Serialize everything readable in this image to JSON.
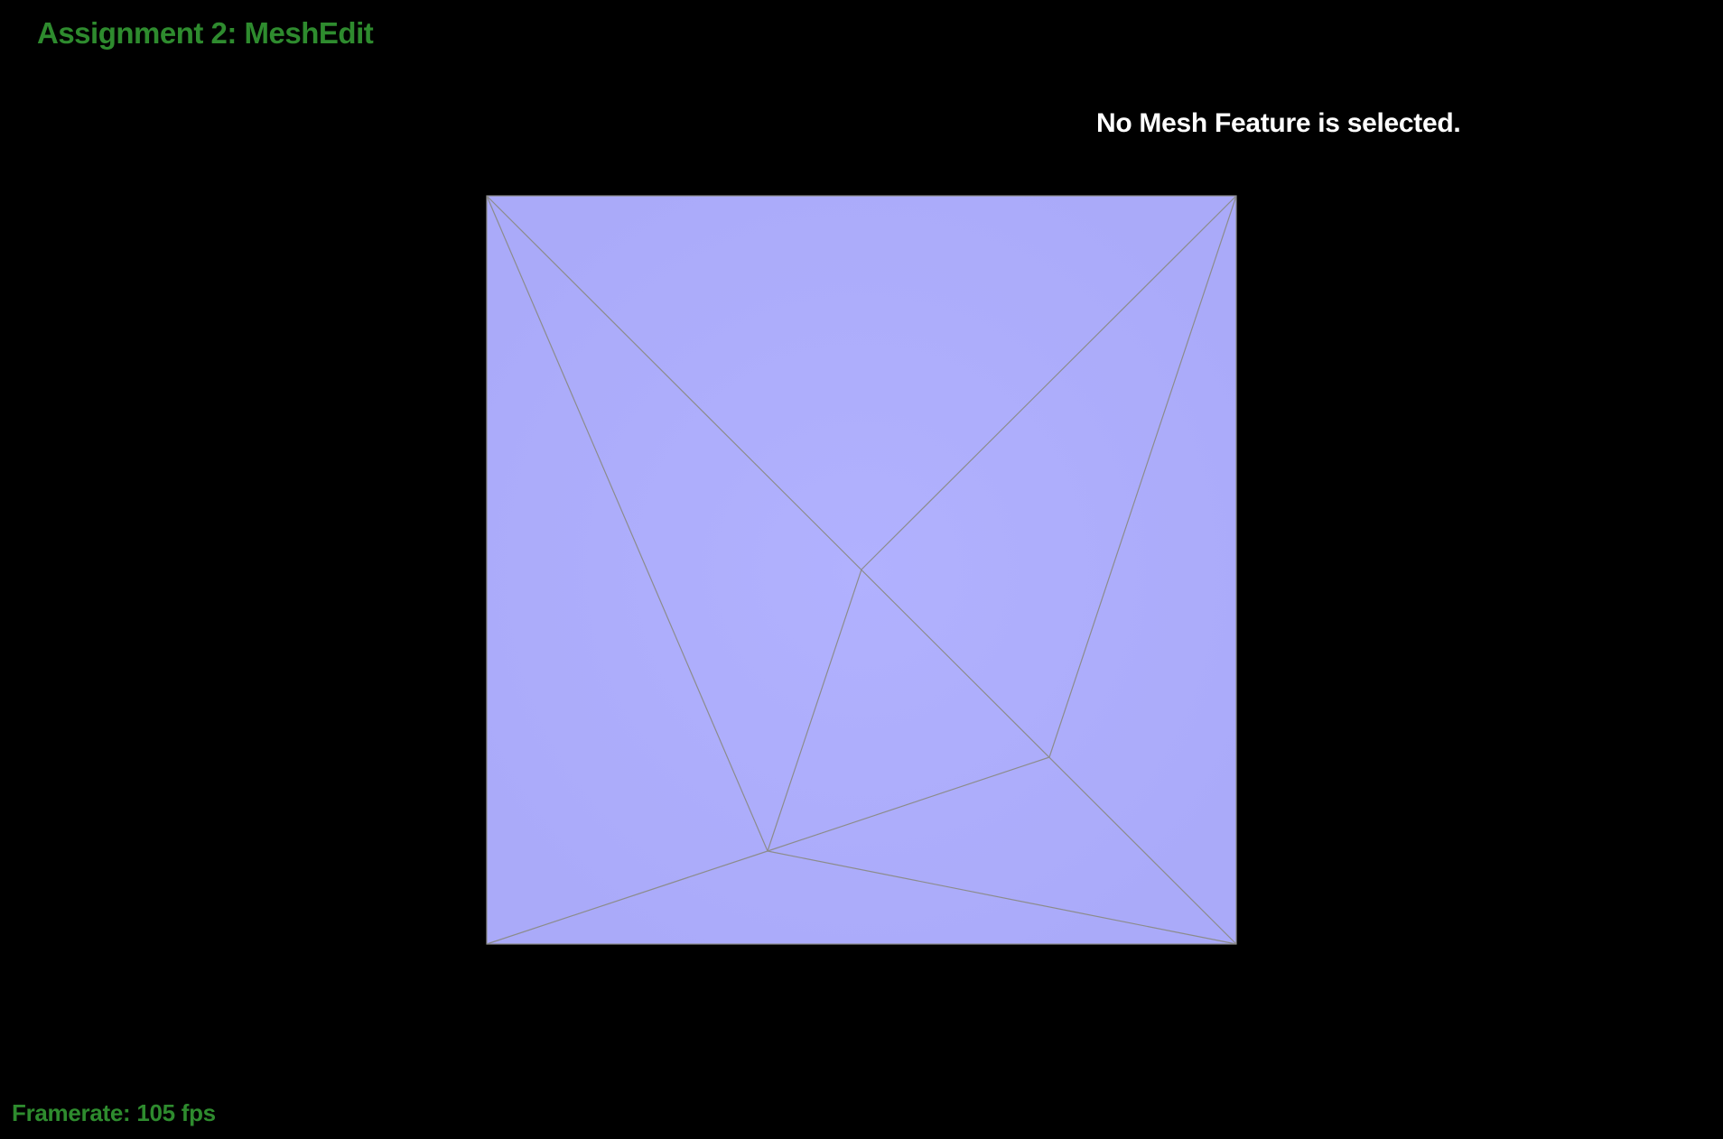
{
  "app": {
    "title": "Assignment 2: MeshEdit"
  },
  "hud": {
    "selection_status": "No Mesh Feature is selected.",
    "framerate": "Framerate: 105 fps"
  },
  "mesh": {
    "fill_color": "#afaffd",
    "edge_color": "#8c8c8c",
    "background_color": "#000000",
    "title_color": "#2e8b2e"
  }
}
